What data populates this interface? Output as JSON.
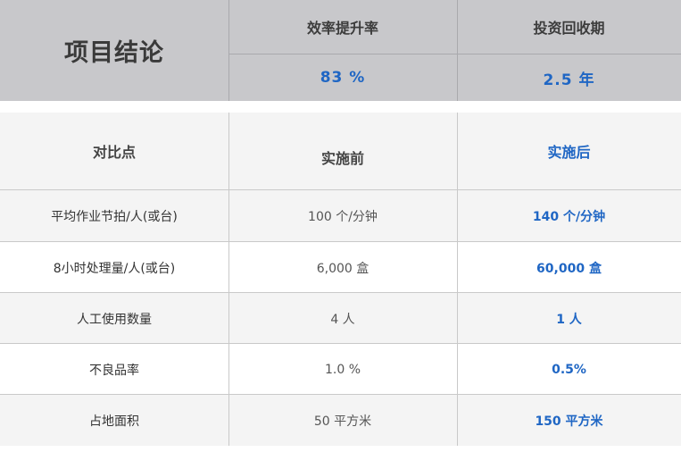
{
  "summary": {
    "title": "项目结论",
    "efficiency_label": "效率提升率",
    "efficiency_value": "83 %",
    "payback_label": "投资回收期",
    "payback_value": "2.5 年"
  },
  "table": {
    "headers": [
      "对比点",
      "实施前",
      "实施后"
    ],
    "rows": [
      {
        "point": "平均作业节拍/人(或台)",
        "before": "100 个/分钟",
        "after": "140 个/分钟"
      },
      {
        "point": "8小时处理量/人(或台)",
        "before": "6,000 盒",
        "after": "60,000 盒"
      },
      {
        "point": "人工使用数量",
        "before": "4 人",
        "after": "1 人"
      },
      {
        "point": "不良品率",
        "before": "1.0 %",
        "after": "0.5%"
      },
      {
        "point": "占地面积",
        "before": "50 平方米",
        "after": "150 平方米"
      }
    ]
  },
  "colors": {
    "summary_bg": "#c8c8cb",
    "accent_blue": "#1f66c4",
    "header_bg": "#f4f4f4"
  }
}
